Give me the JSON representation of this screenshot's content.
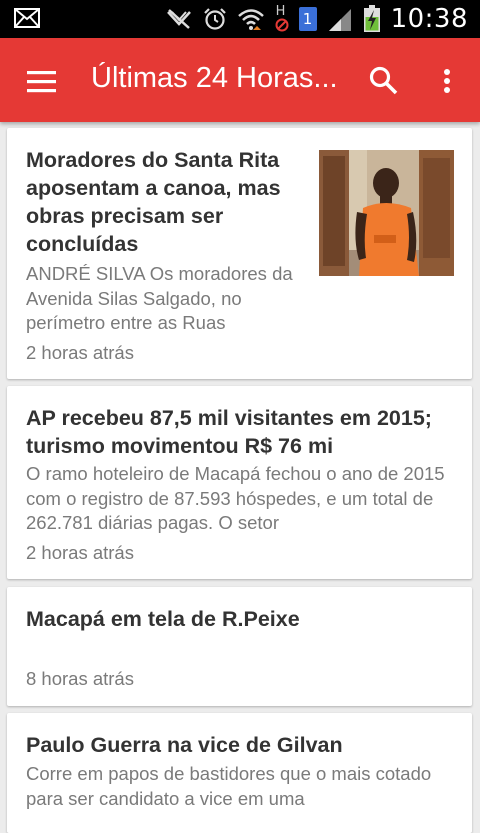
{
  "status_bar": {
    "time": "10:38",
    "icons": [
      "mail-icon",
      "no-signal-icon",
      "alarm-icon",
      "wifi-icon",
      "h-data-icon",
      "sim1-icon",
      "cell-signal-icon",
      "battery-charging-icon"
    ],
    "sim_label": "1",
    "data_label": "H"
  },
  "app_bar": {
    "title": "Últimas 24 Horas...",
    "color": "#e53935",
    "icons": [
      "menu-icon",
      "search-icon",
      "more-vert-icon"
    ]
  },
  "articles": [
    {
      "headline": "Moradores do Santa Rita aposentam a canoa, mas obras precisam ser concluídas",
      "summary": "ANDRÉ SILVA Os moradores da Avenida Silas Salgado, no perímetro entre as Ruas",
      "time": "2 horas atrás",
      "has_image": true
    },
    {
      "headline": "AP recebeu 87,5 mil visitantes em 2015; turismo movimentou R$ 76 mi",
      "summary": "O ramo hoteleiro de Macapá fechou o ano de 2015 com o registro de 87.593 hóspedes, e um total de 262.781 diárias pagas. O setor",
      "time": "2 horas atrás",
      "has_image": false
    },
    {
      "headline": "Macapá em tela de R.Peixe",
      "summary": "",
      "time": "8 horas atrás",
      "has_image": false
    },
    {
      "headline": "Paulo Guerra na vice de Gilvan",
      "summary": "Corre em papos de bastidores que o mais cotado para ser candidato a vice em uma",
      "time": "",
      "has_image": false
    }
  ]
}
